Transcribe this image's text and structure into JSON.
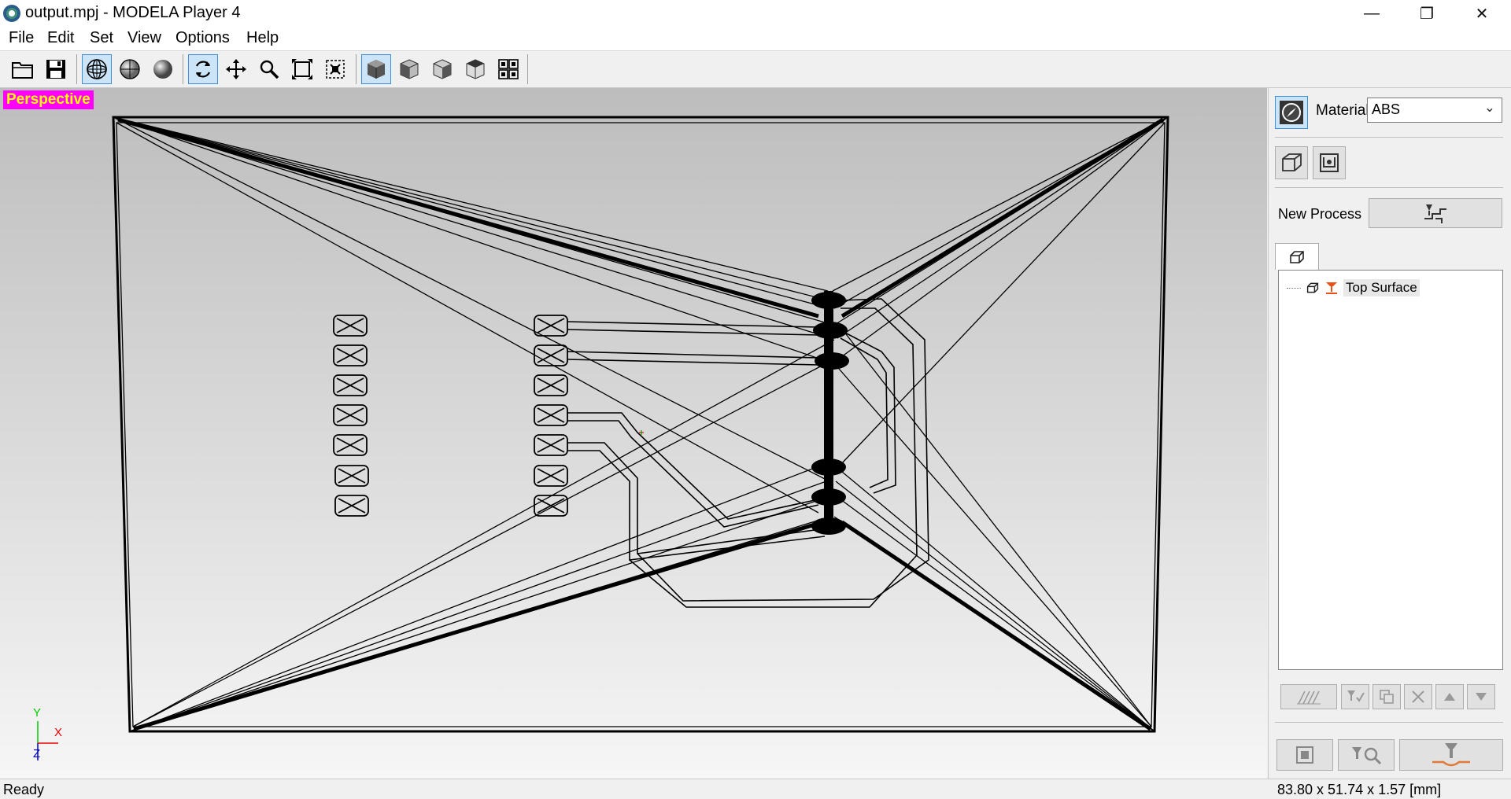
{
  "window": {
    "title": "output.mpj - MODELA Player 4",
    "minimize": "—",
    "restore": "❐",
    "close": "✕"
  },
  "menu": [
    "File",
    "Edit",
    "Set",
    "View",
    "Options",
    "Help"
  ],
  "toolbar": {
    "buttons": [
      "open-file",
      "save-file",
      "wireframe-view",
      "half-render-view",
      "solid-render-view",
      "rotate",
      "pan",
      "zoom",
      "fit-all",
      "zoom-window",
      "perspective-view",
      "front-view",
      "right-view",
      "left-view",
      "multi-view"
    ],
    "active": [
      "wireframe-view",
      "rotate",
      "perspective-view"
    ]
  },
  "viewport": {
    "view_label": "Perspective",
    "axis": {
      "y": "Y",
      "x": "X",
      "z": "Z"
    }
  },
  "panel": {
    "material_label": "Material",
    "material_value": "ABS",
    "new_process_label": "New Process",
    "tree": {
      "items": [
        {
          "label": "Top Surface"
        }
      ]
    }
  },
  "status": {
    "left": "Ready",
    "right": "83.80 x 51.74 x 1.57 [mm]"
  }
}
